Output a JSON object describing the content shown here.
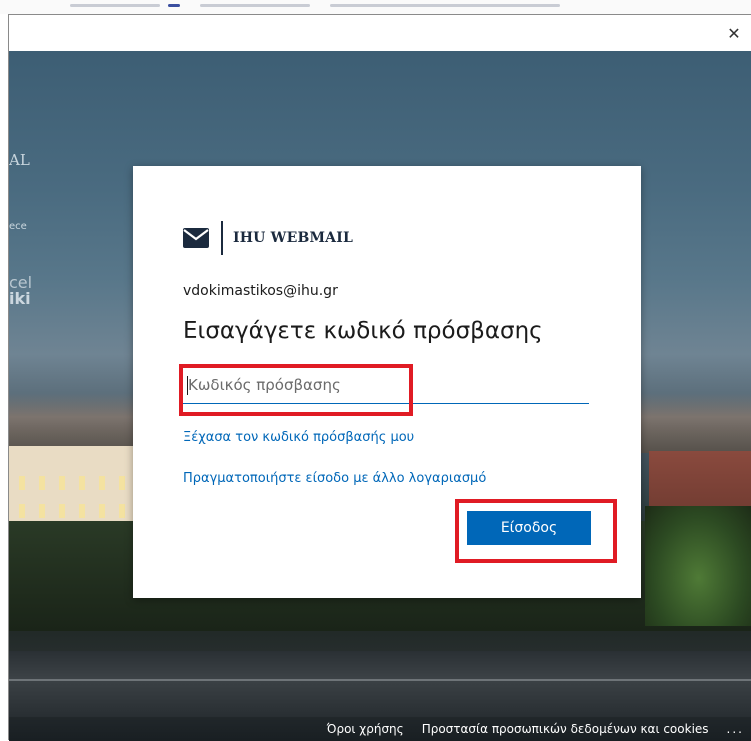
{
  "window": {
    "close_glyph": "✕"
  },
  "background": {
    "side_text_1": "AL",
    "side_text_2": "ece",
    "side_text_3": "cel",
    "side_text_4": "iki"
  },
  "dialog": {
    "logo_text": "IHU WEBMAIL",
    "logo_icon": "envelope-icon",
    "email": "vdokimastikos@ihu.gr",
    "heading": "Εισαγάγετε κωδικό πρόσβασης",
    "password": {
      "value": "",
      "placeholder": "Κωδικός πρόσβασης"
    },
    "forgot_link": "Ξέχασα τον κωδικό πρόσβασής μου",
    "other_account_link": "Πραγματοποιήστε είσοδο με άλλο λογαριασμό",
    "signin_label": "Είσοδος"
  },
  "footer": {
    "terms": "Όροι χρήσης",
    "privacy": "Προστασία προσωπικών δεδομένων και cookies",
    "more": "..."
  },
  "colors": {
    "accent": "#0067b8",
    "highlight": "#e01b24",
    "logo": "#1b2a3e"
  }
}
